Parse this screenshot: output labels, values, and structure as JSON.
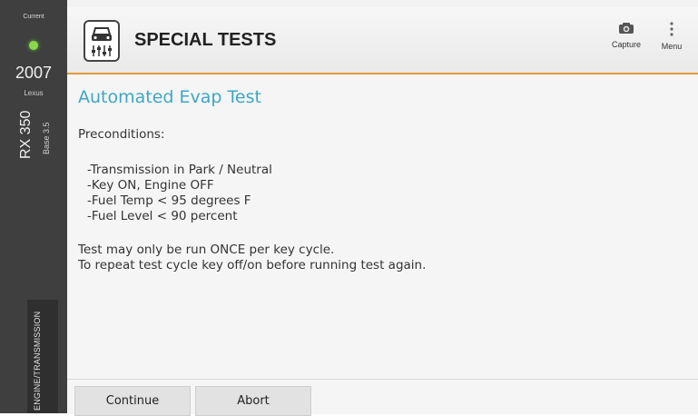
{
  "sidebar": {
    "current_label": "Current",
    "year": "2007",
    "make": "Lexus",
    "model": "RX 350",
    "engine": "Base 3.5",
    "system": "ENGINE/TRANSMISSION",
    "status_color": "#89d84b"
  },
  "header": {
    "title": "SPECIAL TESTS",
    "capture_label": "Capture",
    "menu_label": "Menu",
    "accent": "#e39b3a",
    "icons": [
      "car-tools-icon",
      "camera-icon",
      "more-vert-icon"
    ]
  },
  "content": {
    "title": "Automated Evap Test",
    "preconditions_label": "Preconditions:",
    "conditions": [
      "-Transmission in Park / Neutral",
      "-Key ON, Engine OFF",
      "-Fuel Temp < 95 degrees F",
      "-Fuel Level < 90 percent"
    ],
    "note_1": "Test may only be run ONCE per key cycle.",
    "note_2": "To repeat test cycle key off/on before running test again.",
    "title_color": "#3fa6c4"
  },
  "footer": {
    "continue_label": "Continue",
    "abort_label": "Abort"
  }
}
